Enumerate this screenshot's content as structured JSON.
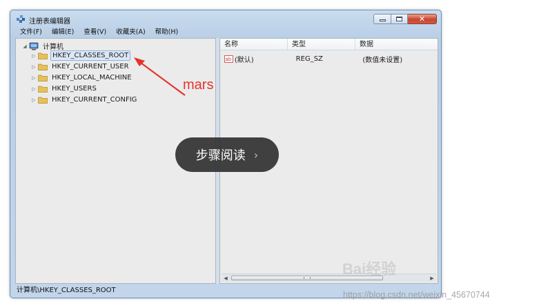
{
  "window": {
    "title": "注册表编辑器"
  },
  "menu": [
    "文件(F)",
    "编辑(E)",
    "查看(V)",
    "收藏夹(A)",
    "帮助(H)"
  ],
  "tree": {
    "root": "计算机",
    "keys": [
      "HKEY_CLASSES_ROOT",
      "HKEY_CURRENT_USER",
      "HKEY_LOCAL_MACHINE",
      "HKEY_USERS",
      "HKEY_CURRENT_CONFIG"
    ],
    "selected": "HKEY_CLASSES_ROOT"
  },
  "list": {
    "columns": [
      "名称",
      "类型",
      "数据"
    ],
    "rows": [
      {
        "name": "(默认)",
        "type": "REG_SZ",
        "data": "(数值未设置)"
      }
    ]
  },
  "status": "计算机\\HKEY_CLASSES_ROOT",
  "overlay": {
    "annotation": "mars",
    "annotation_color": "#e5342a",
    "step_label": "步骤阅读",
    "step_chevron": "›",
    "baidu_watermark": "Bai经验",
    "url_watermark": "https://blog.csdn.net/weixin_45670744"
  },
  "icons": {
    "app": "registry-editor-icon",
    "computer": "computer-icon",
    "folder": "folder-icon",
    "string_value": "string-value-icon"
  }
}
